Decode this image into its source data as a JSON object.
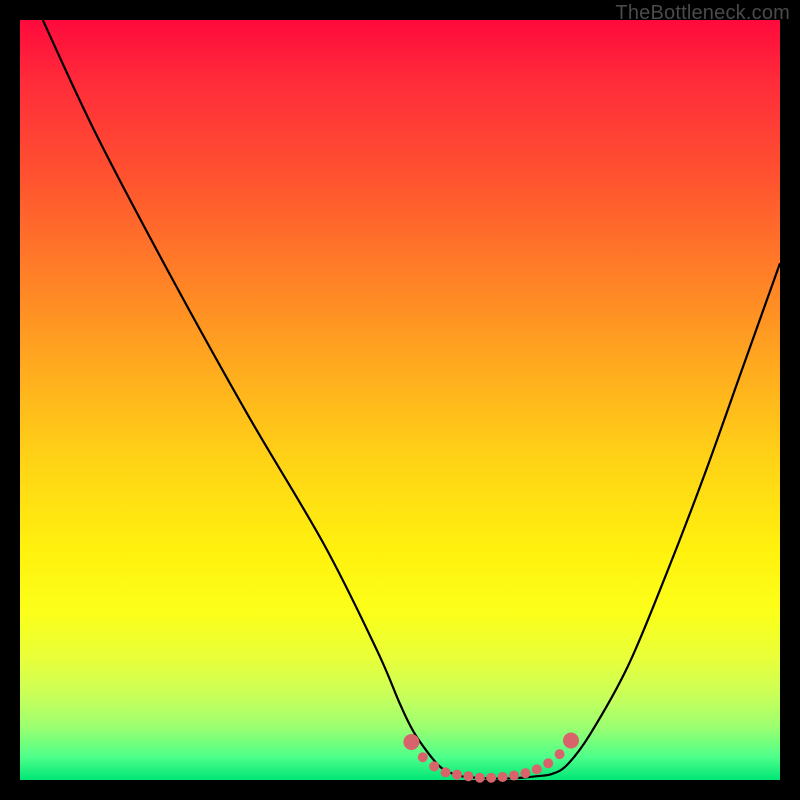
{
  "watermark": "TheBottleneck.com",
  "chart_data": {
    "type": "line",
    "title": "",
    "xlabel": "",
    "ylabel": "",
    "xlim": [
      0,
      100
    ],
    "ylim": [
      0,
      100
    ],
    "series": [
      {
        "name": "bottleneck-curve",
        "x": [
          3,
          10,
          20,
          30,
          40,
          47,
          50,
          52,
          55,
          57,
          58,
          60,
          62,
          64,
          66,
          68,
          70,
          72,
          75,
          80,
          85,
          90,
          95,
          100
        ],
        "values": [
          100,
          85,
          66,
          48,
          31,
          17,
          10,
          6,
          2,
          0.8,
          0.5,
          0.3,
          0.2,
          0.2,
          0.3,
          0.5,
          0.8,
          2,
          6,
          15,
          27,
          40,
          54,
          68
        ]
      }
    ],
    "markers": {
      "name": "optimal-range-dots",
      "x": [
        51.5,
        53,
        54.5,
        56,
        57.5,
        59,
        60.5,
        62,
        63.5,
        65,
        66.5,
        68,
        69.5,
        71,
        72.5
      ],
      "values": [
        5.0,
        3.0,
        1.8,
        1.0,
        0.7,
        0.5,
        0.3,
        0.3,
        0.4,
        0.6,
        0.9,
        1.4,
        2.2,
        3.4,
        5.2
      ],
      "color": "#d9636a",
      "radius_first_last": 8,
      "radius_mid": 5
    },
    "gradient_stops": [
      {
        "pos": 0,
        "color": "#ff0a3c"
      },
      {
        "pos": 50,
        "color": "#ffd316"
      },
      {
        "pos": 80,
        "color": "#fff20e"
      },
      {
        "pos": 100,
        "color": "#00e676"
      }
    ]
  }
}
